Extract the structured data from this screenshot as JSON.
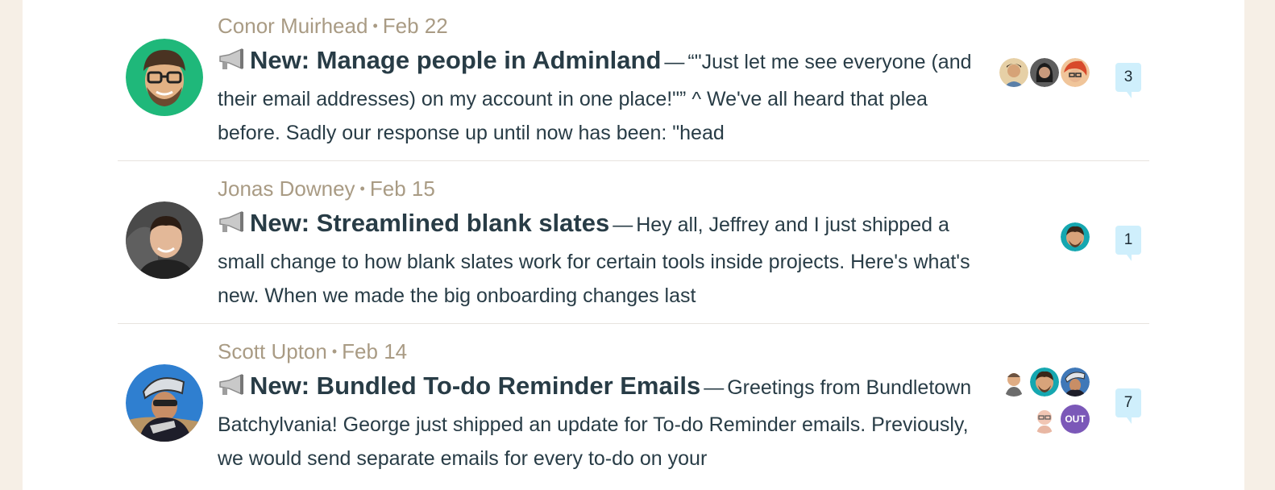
{
  "posts": [
    {
      "author": "Conor Muirhead",
      "date": "Feb 22",
      "title": "New: Manage people in Adminland",
      "excerpt": "“\"Just let me see everyone (and their email addresses) on my account in one place!\"” ^ We've all heard that plea before. Sadly our response up until now has been: \"head",
      "comment_count": "3"
    },
    {
      "author": "Jonas Downey",
      "date": "Feb 15",
      "title": "New: Streamlined blank slates",
      "excerpt": "Hey all, Jeffrey and I just shipped a small change to how blank slates work for certain tools inside projects. Here's what's new. When we made the big onboarding changes last",
      "comment_count": "1"
    },
    {
      "author": "Scott Upton",
      "date": "Feb 14",
      "title": "New: Bundled To-do Reminder Emails",
      "excerpt": "Greetings from Bundletown Batchylvania! George just shipped an update for To-do Reminder emails. Previously, we would send separate emails for every to-do on your",
      "comment_count": "7"
    }
  ],
  "separator_dot": "•",
  "dash": "—",
  "out_badge": "OUT",
  "icons": [
    "megaphone-icon",
    "comment-bubble-icon"
  ],
  "colors": {
    "page_bg": "#f6efe6",
    "meta_text": "#a99b84",
    "body_text": "#283c46",
    "bubble": "#cfeffc",
    "avatar_green": "#1fb87a"
  }
}
